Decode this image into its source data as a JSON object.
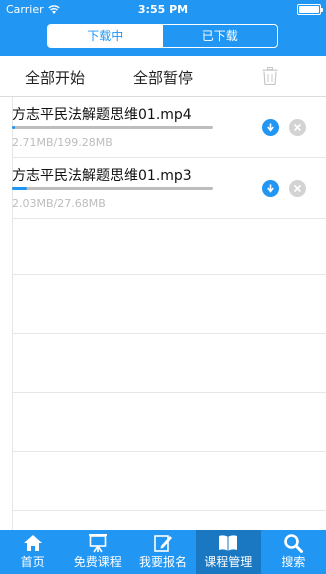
{
  "status_bar": {
    "carrier": "Carrier",
    "time": "3:55 PM"
  },
  "segment": {
    "tabs": [
      {
        "label": "下载中",
        "active": true
      },
      {
        "label": "已下载",
        "active": false
      }
    ]
  },
  "toolbar": {
    "start_all": "全部开始",
    "pause_all": "全部暂停"
  },
  "downloads": [
    {
      "title": "方志平民法解题思维01.mp4",
      "size": "2.71MB/199.28MB",
      "progress": 0.014
    },
    {
      "title": "方志平民法解题思维01.mp3",
      "size": "2.03MB/27.68MB",
      "progress": 0.073
    }
  ],
  "tabbar": {
    "items": [
      {
        "label": "首页",
        "icon": "home-icon",
        "active": false
      },
      {
        "label": "免费课程",
        "icon": "presentation-icon",
        "active": false
      },
      {
        "label": "我要报名",
        "icon": "edit-icon",
        "active": false
      },
      {
        "label": "课程管理",
        "icon": "book-icon",
        "active": true
      },
      {
        "label": "搜索",
        "icon": "search-icon",
        "active": false
      }
    ]
  },
  "colors": {
    "primary": "#2196f3",
    "active_tab": "#1a78c2",
    "muted": "#bdbdbd"
  }
}
